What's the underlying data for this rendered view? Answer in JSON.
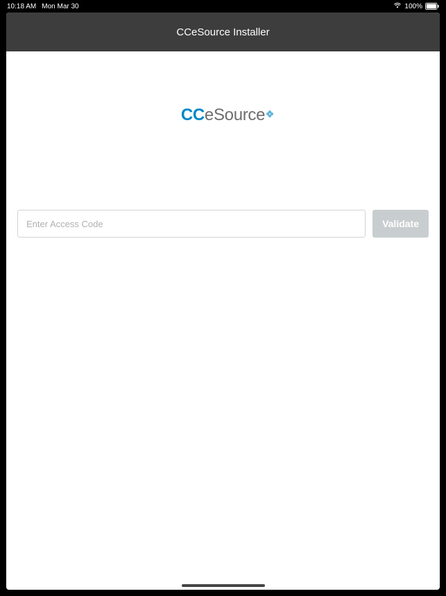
{
  "statusBar": {
    "time": "10:18 AM",
    "date": "Mon Mar 30",
    "batteryPercent": "100%"
  },
  "header": {
    "title": "CCeSource Installer"
  },
  "logo": {
    "part1": "CC",
    "part2": "eSource"
  },
  "form": {
    "accessCodePlaceholder": "Enter Access Code",
    "validateLabel": "Validate"
  }
}
